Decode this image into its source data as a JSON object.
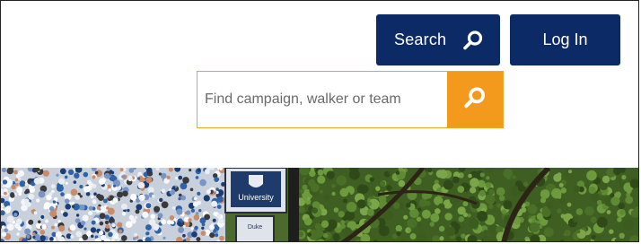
{
  "header": {
    "search_button": {
      "label": "Search",
      "icon": "search-icon"
    },
    "login_button": {
      "label": "Log In"
    }
  },
  "search": {
    "placeholder": "Find campaign, walker or team",
    "value": "",
    "submit_icon": "search-icon"
  },
  "hero": {
    "sign_text": "University",
    "sign_subtext": "Duke"
  },
  "colors": {
    "navy": "#0c2a66",
    "orange": "#f39a1d",
    "orange_border": "#f0a423"
  }
}
